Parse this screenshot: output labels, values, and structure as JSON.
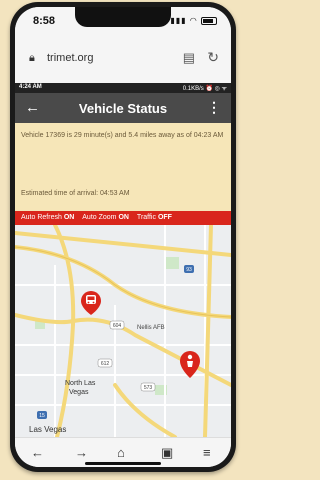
{
  "ios_status": {
    "time": "8:58"
  },
  "browser": {
    "url": "trimet.org"
  },
  "android_status": {
    "time": "4:24 AM",
    "right": "0.1KB/s ⏰ ◎ ᯤ"
  },
  "appbar": {
    "title": "Vehicle Status"
  },
  "info": {
    "message": "Vehicle 17369 is 29 minute(s) and 5.4 miles away as of 04:23 AM",
    "eta": "Estimated time of arrival: 04:53 AM"
  },
  "toggles": {
    "auto_refresh_label": "Auto Refresh",
    "auto_refresh_value": "ON",
    "auto_zoom_label": "Auto Zoom",
    "auto_zoom_value": "ON",
    "traffic_label": "Traffic",
    "traffic_value": "OFF"
  },
  "map": {
    "labels": {
      "nellis": "Nellis AFB",
      "north_las_vegas_1": "North Las",
      "north_las_vegas_2": "Vegas",
      "las_vegas": "Las Vegas",
      "shield_604": "604",
      "shield_93": "93",
      "shield_612": "612",
      "shield_573": "573",
      "shield_15": "15"
    }
  },
  "colors": {
    "accent_red": "#d9261c",
    "info_bg": "#f6e6b8",
    "appbar": "#4a4a4a"
  },
  "icons": {
    "lock": "lock-icon",
    "reader": "reader-icon",
    "reload": "reload-icon",
    "back": "back-arrow-icon",
    "menu": "more-vert-icon",
    "nav_back": "arrow-left-icon",
    "nav_forward": "arrow-right-icon",
    "nav_home": "home-icon",
    "nav_tabs": "tabs-icon",
    "nav_menu": "hamburger-icon"
  }
}
